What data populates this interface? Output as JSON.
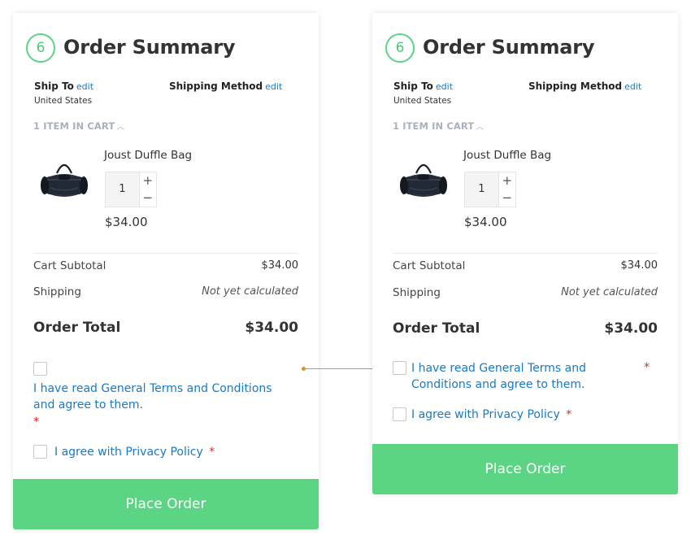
{
  "summary": {
    "step_number": "6",
    "title": "Order Summary",
    "ship_to_label": "Ship To",
    "ship_to_edit": "edit",
    "ship_to_value": "United States",
    "shipping_method_label": "Shipping Method",
    "shipping_method_edit": "edit",
    "cart_toggle": "1 ITEM IN CART",
    "product": {
      "name": "Joust Duffle Bag",
      "qty": "1",
      "plus": "+",
      "minus": "−",
      "price": "$34.00"
    },
    "subtotal_label": "Cart Subtotal",
    "subtotal_value": "$34.00",
    "shipping_label": "Shipping",
    "shipping_value": "Not yet calculated",
    "total_label": "Order Total",
    "total_value": "$34.00",
    "terms_text": "I have read General Terms and Conditions and agree to them.",
    "privacy_text": "I agree with Privacy Policy",
    "required_mark": "*",
    "place_order": "Place Order"
  },
  "colors": {
    "accent_green": "#5bd484",
    "link_blue": "#1979c3",
    "required_red": "#e02b27",
    "connector_orange": "#e3902a"
  }
}
